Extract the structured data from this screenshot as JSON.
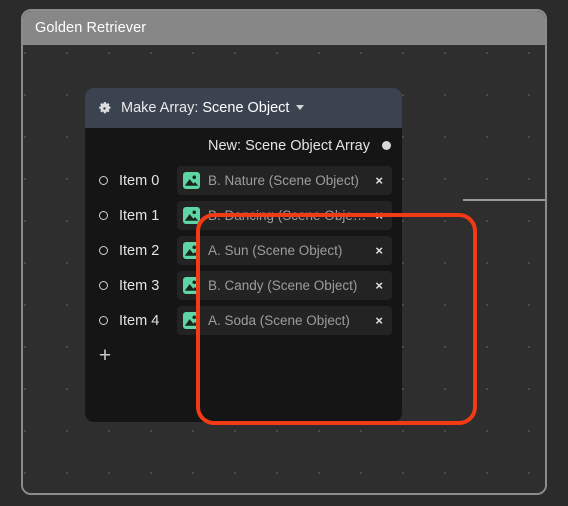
{
  "window": {
    "title": "Golden Retriever"
  },
  "node": {
    "gear_icon": "gear-icon",
    "title_prefix": "Make Array:",
    "title_type": "Scene Object",
    "dropdown_caret": "chevron-down-icon",
    "output": {
      "label": "New: Scene Object Array",
      "port_icon": "output-port-dot"
    },
    "items": [
      {
        "label": "Item 0",
        "value": "B. Nature (Scene Object)",
        "icon": "image-asset-icon",
        "remove": "×"
      },
      {
        "label": "Item 1",
        "value": "B. Dancing (Scene Obje…",
        "icon": "image-asset-icon",
        "remove": "×"
      },
      {
        "label": "Item 2",
        "value": "A. Sun (Scene Object)",
        "icon": "image-asset-icon",
        "remove": "×"
      },
      {
        "label": "Item 3",
        "value": "B. Candy (Scene Object)",
        "icon": "image-asset-icon",
        "remove": "×"
      },
      {
        "label": "Item 4",
        "value": "A. Soda (Scene Object)",
        "icon": "image-asset-icon",
        "remove": "×"
      }
    ],
    "add_label": "+"
  },
  "annotation": {
    "highlight_color": "#f23a14"
  },
  "colors": {
    "canvas": "#2e2e2e",
    "titlebar": "#878787",
    "node_body": "#151515",
    "node_header": "#3c4350",
    "chip": "#232323",
    "asset_icon": "#5fd4a4",
    "text": "#e4e4e4",
    "muted_text": "#9d9d9d",
    "wire": "#9a9a9a"
  }
}
